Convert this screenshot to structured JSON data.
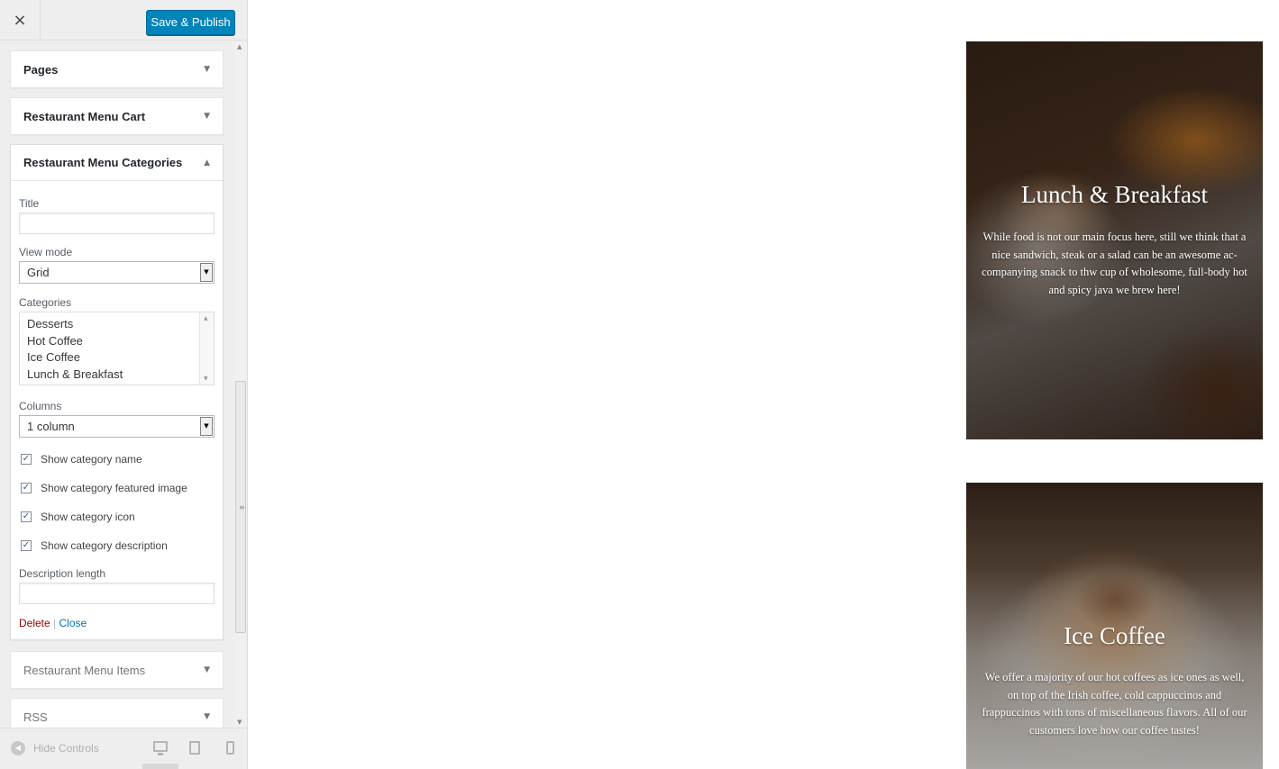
{
  "header": {
    "close_label": "×",
    "publish_label": "Save & Publish"
  },
  "sections": {
    "pages": {
      "title": "Pages",
      "arrow": "▼"
    },
    "menu_cart": {
      "title": "Restaurant Menu Cart",
      "arrow": "▼"
    },
    "menu_categories": {
      "title": "Restaurant Menu Categories",
      "arrow": "▲",
      "title_label": "Title",
      "title_value": "",
      "view_mode_label": "View mode",
      "view_mode_value": "Grid",
      "categories_label": "Categories",
      "categories": [
        "Desserts",
        "Hot Coffee",
        "Ice Coffee",
        "Lunch & Breakfast"
      ],
      "columns_label": "Columns",
      "columns_value": "1 column",
      "checkboxes": [
        {
          "label": "Show category name",
          "checked": true
        },
        {
          "label": "Show category featured image",
          "checked": true
        },
        {
          "label": "Show category icon",
          "checked": true
        },
        {
          "label": "Show category description",
          "checked": true
        }
      ],
      "check_glyph": "✓",
      "description_length_label": "Description length",
      "description_length_value": "",
      "delete_label": "Delete",
      "separator": "|",
      "close_label": "Close"
    },
    "menu_items": {
      "title": "Restaurant Menu Items",
      "arrow": "▼"
    },
    "rss": {
      "title": "RSS",
      "arrow": "▼"
    }
  },
  "footer": {
    "hide_controls_label": "Hide Controls",
    "hide_icon": "◀"
  },
  "preview": {
    "cards": [
      {
        "title": "Lunch & Breakfast",
        "description": "While food is not our main focus here, still we think that a nice sandwich, steak or a salad can be an awesome ac- companying snack to thw cup of wholesome, full-body hot and spicy java we brew here!"
      },
      {
        "title": "Ice Coffee",
        "description": "We offer a majority of our hot coffees as ice ones as well, on top of the Irish coffee, cold cappuccinos and frappuccinos with tons of miscellaneous flavors. All of our customers love how our coffee tastes!"
      }
    ]
  },
  "colors": {
    "publish_button": "#0085ba",
    "delete_link": "#a00000",
    "close_link": "#0073aa",
    "sidebar_bg": "#eeeeee"
  },
  "icons": {
    "close": "close-icon",
    "collapse": "chevron-down-icon",
    "expand": "chevron-up-icon",
    "hide_controls": "collapse-arrow-icon",
    "desktop": "desktop-icon",
    "tablet": "tablet-icon",
    "mobile": "mobile-icon"
  }
}
